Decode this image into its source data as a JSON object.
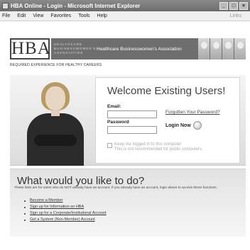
{
  "window": {
    "title": "HBA Online - Login - Microsoft Internet Explorer",
    "buttons": [
      "_",
      "□",
      "×"
    ]
  },
  "menu": {
    "items": [
      "File",
      "Edit",
      "View",
      "Favorites",
      "Tools",
      "Help"
    ],
    "links_label": "Links"
  },
  "header": {
    "logo_text": "HBA",
    "logo_sub_lines": [
      "HEALTHCARE",
      "BUSINESSWOMEN'S",
      "ASSOCIATION"
    ],
    "assoc_name": "Healthcare Businesswomen's Association",
    "tagline": "REQUIRED EXPERIENCE FOR HEALTHY CAREERS"
  },
  "login": {
    "welcome": "Welcome Existing Users!",
    "email_label": "Email:",
    "email_value": "",
    "password_label": "Password",
    "password_value": "",
    "forgot_link": "Forgotten Your Password?",
    "login_button": "Login Now",
    "keep_logged_in": "Keep me logged in to this computer",
    "keep_note": "This is not recommended for public computers."
  },
  "what": {
    "title": "What would you like to do?",
    "description": "These links are for users who do NOT already have an account. If you already have an account, login above to access these functions.",
    "links": [
      "Become a Member",
      "Sign up for Information on HBA",
      "Sign up for a Corporate/Institutional Account",
      "Get a System (Non-Member) Account"
    ]
  },
  "colors": {
    "header_strip": "#6e6e6e",
    "titlebar": "#6b6b6b"
  }
}
